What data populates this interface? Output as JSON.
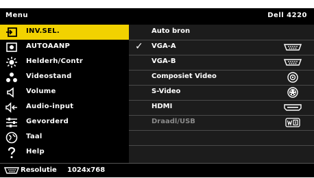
{
  "header": {
    "title": "Menu",
    "model": "Dell 4220"
  },
  "menu": {
    "items": [
      {
        "label": "INV.SEL.",
        "icon": "input-icon",
        "selected": true
      },
      {
        "label": "AUTOAANP",
        "icon": "auto-adjust-icon"
      },
      {
        "label": "Helderh/Contr",
        "icon": "brightness-icon"
      },
      {
        "label": "Videostand",
        "icon": "video-mode-icon"
      },
      {
        "label": "Volume",
        "icon": "speaker-icon"
      },
      {
        "label": "Audio-input",
        "icon": "audio-input-icon"
      },
      {
        "label": "Gevorderd",
        "icon": "advanced-settings-icon"
      },
      {
        "label": "Taal",
        "icon": "language-icon"
      },
      {
        "label": "Help",
        "icon": "help-icon"
      }
    ]
  },
  "options": {
    "items": [
      {
        "label": "Auto bron"
      },
      {
        "label": "VGA-A",
        "checked": true,
        "icon": "vga-port-icon"
      },
      {
        "label": "VGA-B",
        "icon": "vga-port-icon"
      },
      {
        "label": "Composiet Video",
        "icon": "composite-port-icon"
      },
      {
        "label": "S-Video",
        "icon": "s-video-port-icon"
      },
      {
        "label": "HDMI",
        "icon": "hdmi-port-icon"
      },
      {
        "label": "Draadl/USB",
        "icon": "wireless-usb-icon",
        "disabled": true
      },
      {
        "label": ""
      },
      {
        "label": ""
      }
    ]
  },
  "footer": {
    "resolution_label": "Resolutie",
    "resolution_value": "1024x768",
    "icon": "resolution-icon"
  },
  "colors": {
    "highlight": "#f2d200",
    "background": "#000000",
    "panel": "#1c1c1c"
  }
}
